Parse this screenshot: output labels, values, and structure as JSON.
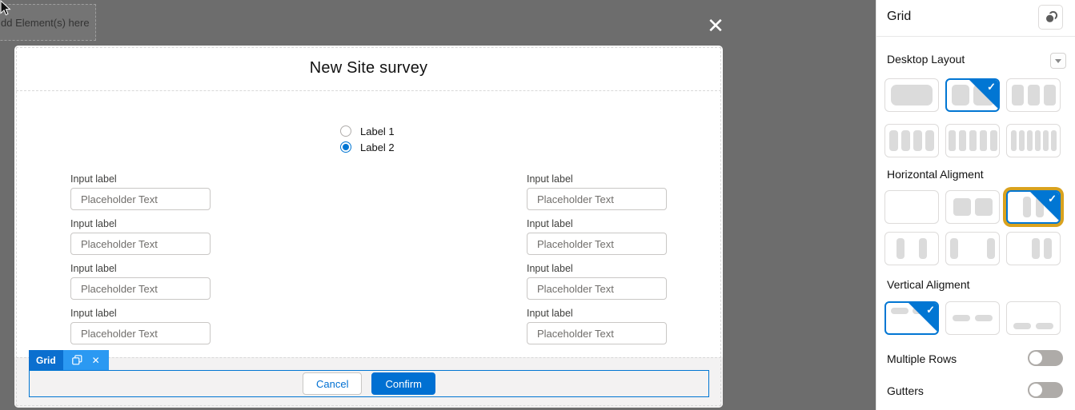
{
  "canvas": {
    "drop_zone_label": "dd Element(s) here",
    "close_icon": "✕"
  },
  "modal": {
    "title": "New Site survey",
    "radios": [
      {
        "label": "Label 1",
        "selected": false
      },
      {
        "label": "Label 2",
        "selected": true
      }
    ],
    "form_rows": [
      {
        "label": "Input label",
        "placeholder": "Placeholder Text"
      },
      {
        "label": "Input label",
        "placeholder": "Placeholder Text"
      },
      {
        "label": "Input label",
        "placeholder": "Placeholder Text"
      },
      {
        "label": "Input label",
        "placeholder": "Placeholder Text"
      }
    ],
    "selection": {
      "badge_label": "Grid",
      "remove_icon": "✕"
    },
    "footer": {
      "cancel": "Cancel",
      "confirm": "Confirm"
    }
  },
  "panel": {
    "title": "Grid",
    "desktop_layout": {
      "title": "Desktop Layout",
      "options": [
        {
          "name": "1-column",
          "selected": false
        },
        {
          "name": "2-column",
          "selected": true
        },
        {
          "name": "3-column",
          "selected": false
        },
        {
          "name": "4-column",
          "selected": false
        },
        {
          "name": "5-column",
          "selected": false
        },
        {
          "name": "6-column",
          "selected": false
        }
      ]
    },
    "horizontal_alignment": {
      "title": "Horizontal Aligment",
      "options": [
        {
          "name": "none",
          "selected": false
        },
        {
          "name": "stretch",
          "selected": false
        },
        {
          "name": "center",
          "selected": true,
          "highlighted": true
        },
        {
          "name": "space-around",
          "selected": false
        },
        {
          "name": "space-between",
          "selected": false
        },
        {
          "name": "end",
          "selected": false
        }
      ]
    },
    "vertical_alignment": {
      "title": "Vertical Aligment",
      "options": [
        {
          "name": "top",
          "selected": true
        },
        {
          "name": "middle",
          "selected": false
        },
        {
          "name": "bottom",
          "selected": false
        }
      ]
    },
    "toggles": [
      {
        "label": "Multiple Rows",
        "on": false
      },
      {
        "label": "Gutters",
        "on": false
      }
    ]
  },
  "colors": {
    "accent_blue": "#0176d3",
    "confirm_blue": "#0070d2",
    "badge_light_blue": "#2b99f2",
    "highlight_gold": "#d9a21e",
    "overlay_gray": "#6d6d6d"
  }
}
